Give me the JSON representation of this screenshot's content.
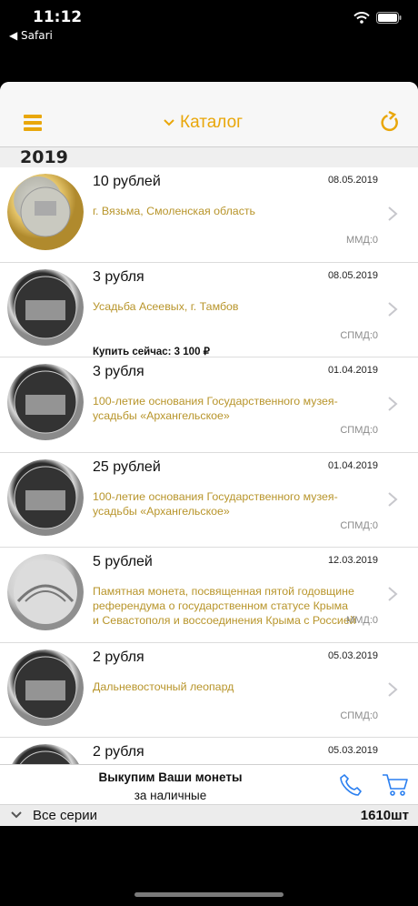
{
  "status_bar": {
    "time": "11:12",
    "back_app": "Safari"
  },
  "navbar": {
    "title": "Каталог",
    "menu_icon": "hamburger-icon",
    "refresh_icon": "refresh-icon",
    "accent": "#e9a70b"
  },
  "section": {
    "year": "2019"
  },
  "coins": [
    {
      "denom": "10 рублей",
      "date": "08.05.2019",
      "desc": "г. Вязьма, Смоленская область",
      "buy": "",
      "mint": "ММД:0",
      "style": "bimetal"
    },
    {
      "denom": "3 рубля",
      "date": "08.05.2019",
      "desc": "Усадьба Асеевых, г. Тамбов",
      "buy": "Купить сейчас: 3 100 ₽",
      "mint": "СПМД:0",
      "style": "proof"
    },
    {
      "denom": "3 рубля",
      "date": "01.04.2019",
      "desc": "100-летие основания Государственного музея-усадьбы «Архангельское»",
      "buy": "",
      "mint": "СПМД:0",
      "style": "proof"
    },
    {
      "denom": "25 рублей",
      "date": "01.04.2019",
      "desc": "100-летие основания Государственного музея-усадьбы «Архангельское»",
      "buy": "",
      "mint": "СПМД:0",
      "style": "proof"
    },
    {
      "denom": "5 рублей",
      "date": "12.03.2019",
      "desc": "Памятная монета, посвященная пятой годовщине референдума о государственном статусе Крыма и Севастополя и воссоединения Крыма с Россией",
      "buy": "",
      "mint": "ММД:0",
      "style": "silver"
    },
    {
      "denom": "2 рубля",
      "date": "05.03.2019",
      "desc": "Дальневосточный леопард",
      "buy": "",
      "mint": "СПМД:0",
      "style": "proof"
    },
    {
      "denom": "2 рубля",
      "date": "05.03.2019",
      "desc": "",
      "buy": "",
      "mint": "",
      "style": "proof"
    }
  ],
  "bottom_bar": {
    "line1": "Выкупим Ваши монеты",
    "line2": "за наличные",
    "phone_icon": "phone-icon",
    "cart_icon": "cart-icon"
  },
  "series_bar": {
    "label": "Все серии",
    "count": "1610шт"
  }
}
